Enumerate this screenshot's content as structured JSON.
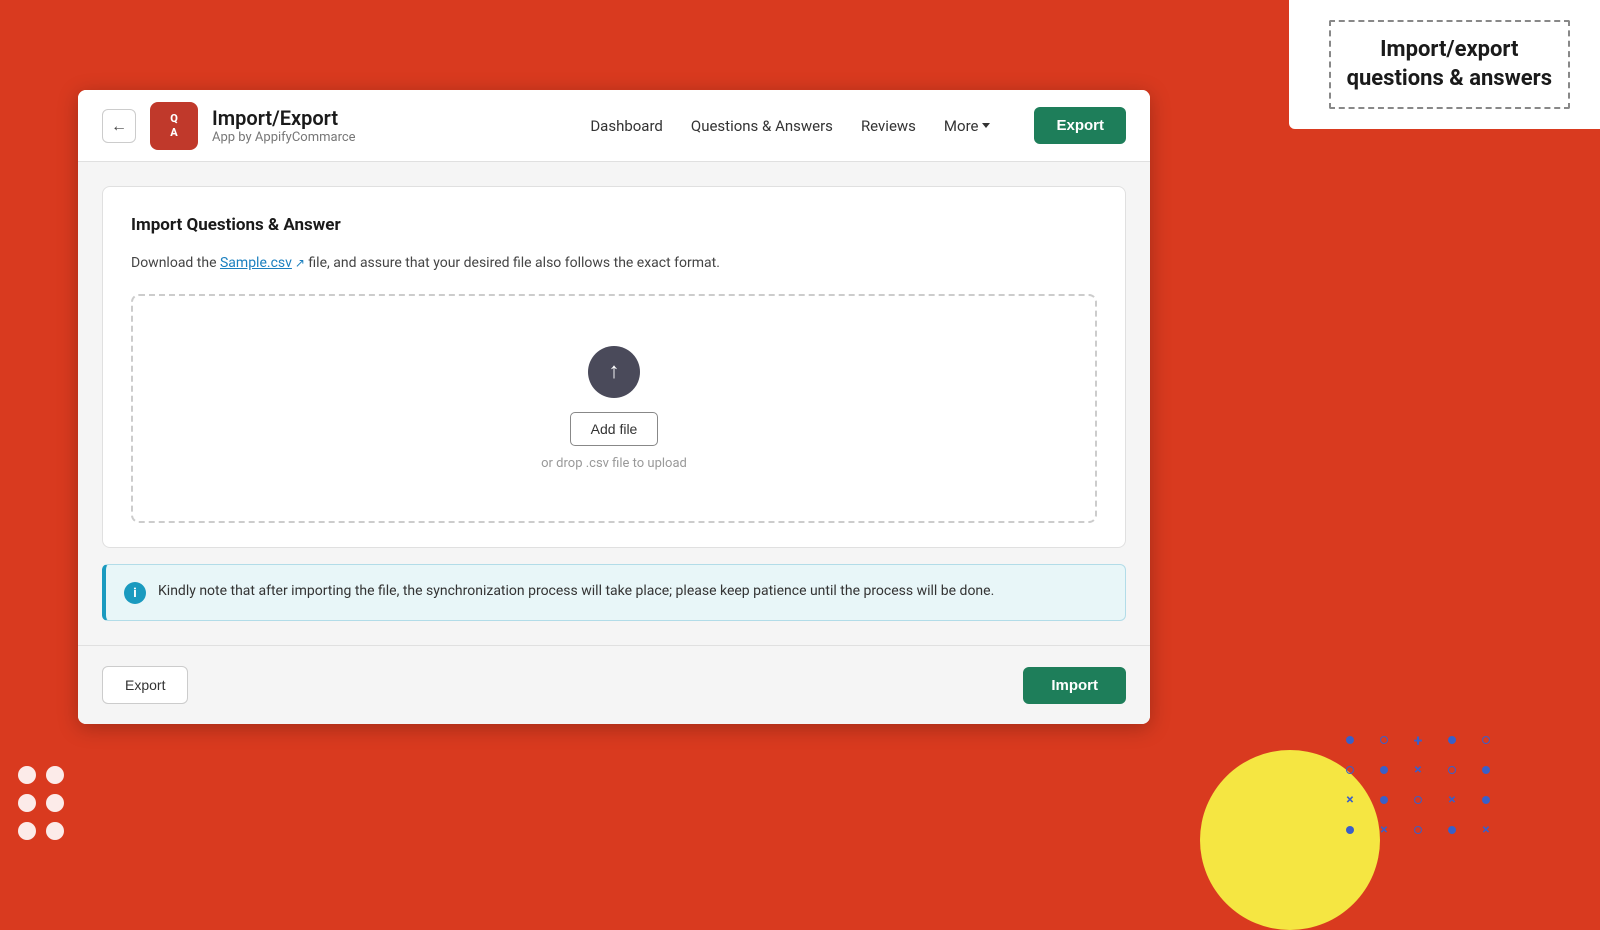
{
  "banner": {
    "title": "Import/export\nquestions & answers"
  },
  "header": {
    "back_label": "←",
    "logo_text": "Q\nA",
    "app_title": "Import/Export",
    "app_subtitle": "App by AppifyCommarce",
    "nav": {
      "dashboard": "Dashboard",
      "questions_answers": "Questions & Answers",
      "reviews": "Reviews",
      "more": "More",
      "export_button": "Export"
    }
  },
  "main": {
    "section_title": "Import Questions & Answer",
    "instruction_prefix": "Download the ",
    "sample_link_label": "Sample.csv",
    "instruction_suffix": " file, and assure that your desired file also follows the exact format.",
    "upload": {
      "add_file_label": "Add file",
      "drop_hint": "or drop .csv file to upload"
    },
    "info_message": "Kindly note that after importing the file, the synchronization process will take place; please keep patience until the process will be done."
  },
  "footer": {
    "export_label": "Export",
    "import_label": "Import"
  },
  "decorative": {
    "dots_grid": [
      "•",
      "•",
      "•",
      "•",
      "•",
      "•"
    ]
  }
}
